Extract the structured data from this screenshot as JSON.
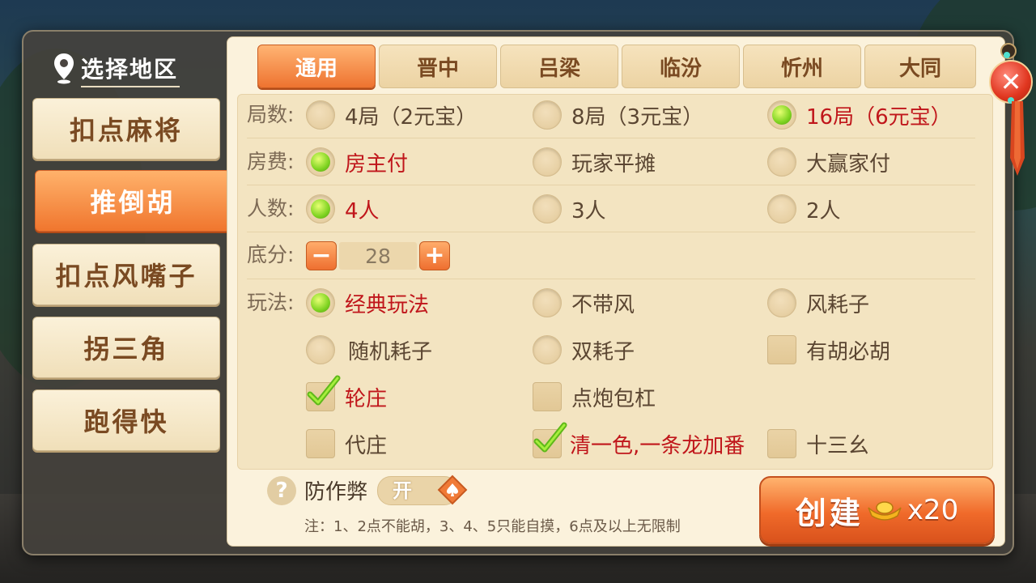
{
  "sidebar": {
    "title": "选择地区",
    "games": [
      {
        "label": "扣点麻将",
        "active": false
      },
      {
        "label": "推倒胡",
        "active": true
      },
      {
        "label": "扣点风嘴子",
        "active": false
      },
      {
        "label": "拐三角",
        "active": false
      },
      {
        "label": "跑得快",
        "active": false
      }
    ]
  },
  "tabs": [
    {
      "label": "通用",
      "active": true
    },
    {
      "label": "晋中",
      "active": false
    },
    {
      "label": "吕梁",
      "active": false
    },
    {
      "label": "临汾",
      "active": false
    },
    {
      "label": "忻州",
      "active": false
    },
    {
      "label": "大同",
      "active": false
    }
  ],
  "settings": {
    "rounds": {
      "label": "局数:",
      "options": [
        "4局（2元宝）",
        "8局（3元宝）",
        "16局（6元宝）"
      ]
    },
    "fee": {
      "label": "房费:",
      "options": [
        "房主付",
        "玩家平摊",
        "大赢家付"
      ]
    },
    "players": {
      "label": "人数:",
      "options": [
        "4人",
        "3人",
        "2人"
      ]
    },
    "base_score": {
      "label": "底分:",
      "value": "28",
      "minus": "−",
      "plus": "+"
    },
    "play": {
      "label": "玩法:",
      "options": [
        "经典玩法",
        "不带风",
        "风耗子",
        "随机耗子",
        "双耗子",
        "有胡必胡",
        "轮庄",
        "点炮包杠",
        "代庄",
        "清一色,一条龙加番",
        "十三幺"
      ]
    }
  },
  "anti_cheat": {
    "help": "?",
    "label": "防作弊",
    "toggle": "开"
  },
  "note": "注：1、2点不能胡，3、4、5只能自摸，6点及以上无限制",
  "create": {
    "label": "创建",
    "cost": "x20"
  },
  "close": "✕",
  "colors": {
    "accent": "#f0762e",
    "selected_text": "#c0161b",
    "radio_on": "#7ed321"
  }
}
